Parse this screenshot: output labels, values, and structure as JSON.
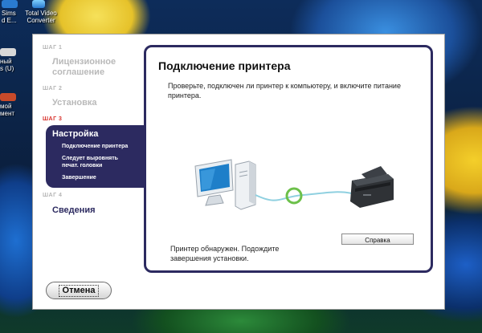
{
  "desktop": {
    "icons": [
      {
        "label": "Sims\nd E...",
        "color": "#2a7bd0"
      },
      {
        "label": "Total Video\nConverter",
        "color": "#3aa0e6"
      },
      {
        "label": "ный\ns (U)",
        "color": "#d8d8d8"
      },
      {
        "label": "мой\nмент",
        "color": "#c84a2a"
      }
    ]
  },
  "sidebar": {
    "step1_label": "ШАГ 1",
    "step1_title": "Лицензионное\nсоглашение",
    "step2_label": "ШАГ 2",
    "step2_title": "Установка",
    "step3_label": "ШАГ 3",
    "step3_title": "Настройка",
    "step3_items": [
      "Подключение принтера",
      "Следует выровнять\nпечат. головки",
      "Завершение"
    ],
    "step4_label": "ШАГ 4",
    "step4_title": "Сведения"
  },
  "panel": {
    "title": "Подключение принтера",
    "description": "Проверьте, подключен ли принтер к компьютеру, и включите питание принтера.",
    "status": "Принтер обнаружен. Подождите завершения установки.",
    "help_label": "Справка"
  },
  "footer": {
    "cancel_label": "Отмена"
  },
  "colors": {
    "accent": "#2c2a60",
    "active_step": "#d8302a",
    "connection": "#6cc04a"
  }
}
